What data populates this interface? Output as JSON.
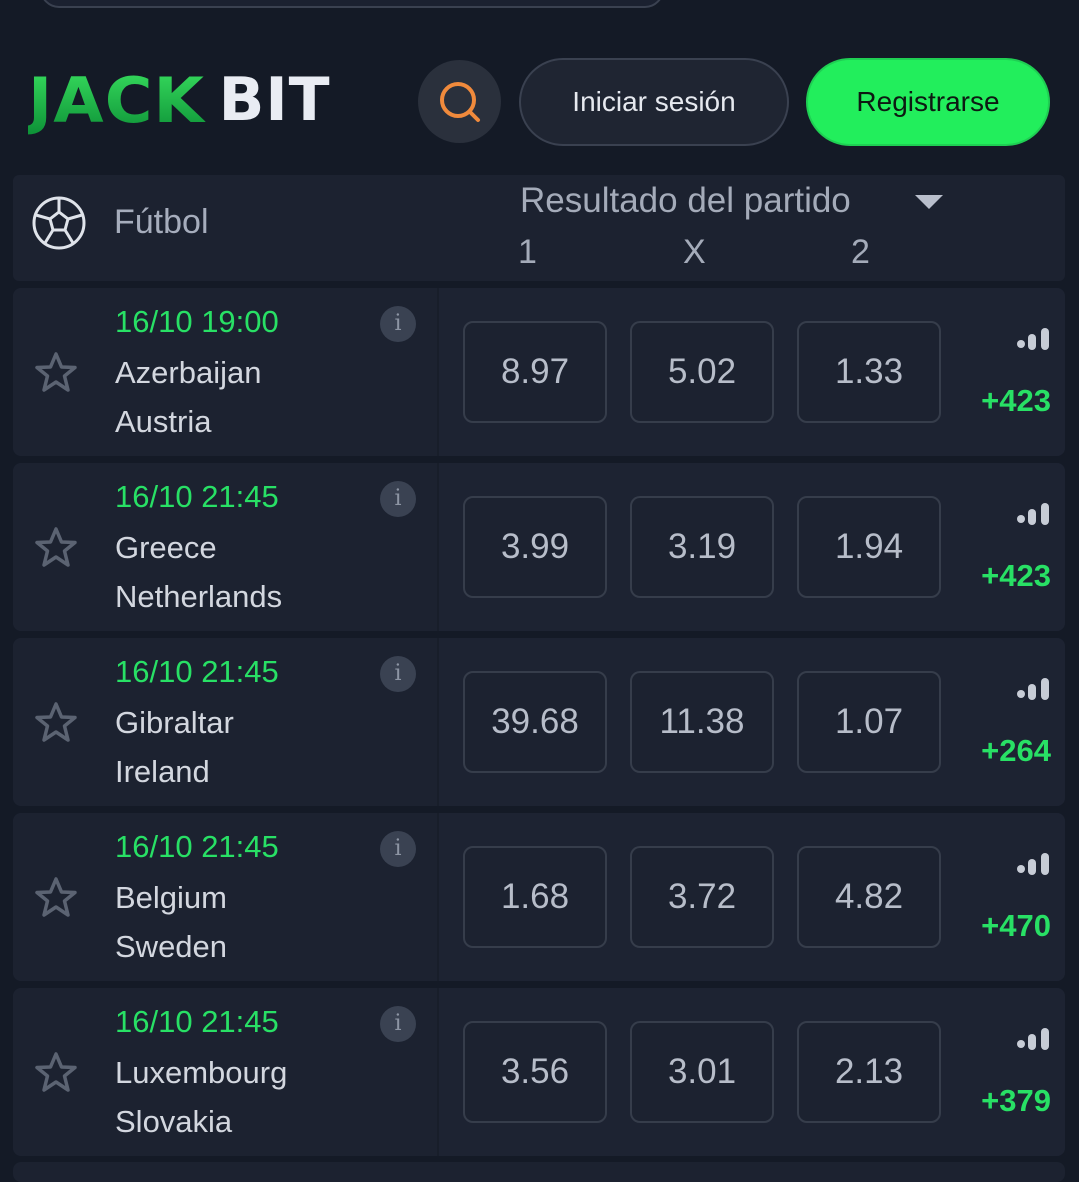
{
  "header": {
    "logo_jack": "JACK",
    "logo_bit": "BIT",
    "search_icon": "search-icon",
    "login_label": "Iniciar sesión",
    "register_label": "Registrarse"
  },
  "sport_header": {
    "sport_name": "Fútbol",
    "market": "Resultado del partido",
    "columns": [
      "1",
      "X",
      "2"
    ]
  },
  "colors": {
    "accent_green": "#22ee5c",
    "background": "#141a26",
    "card": "#1c2230"
  },
  "matches": [
    {
      "time": "16/10 19:00",
      "team1": "Azerbaijan",
      "team2": "Austria",
      "odds": [
        "8.97",
        "5.02",
        "1.33"
      ],
      "more": "+423"
    },
    {
      "time": "16/10 21:45",
      "team1": "Greece",
      "team2": "Netherlands",
      "odds": [
        "3.99",
        "3.19",
        "1.94"
      ],
      "more": "+423"
    },
    {
      "time": "16/10 21:45",
      "team1": "Gibraltar",
      "team2": "Ireland",
      "odds": [
        "39.68",
        "11.38",
        "1.07"
      ],
      "more": "+264"
    },
    {
      "time": "16/10 21:45",
      "team1": "Belgium",
      "team2": "Sweden",
      "odds": [
        "1.68",
        "3.72",
        "4.82"
      ],
      "more": "+470"
    },
    {
      "time": "16/10 21:45",
      "team1": "Luxembourg",
      "team2": "Slovakia",
      "odds": [
        "3.56",
        "3.01",
        "2.13"
      ],
      "more": "+379"
    }
  ]
}
